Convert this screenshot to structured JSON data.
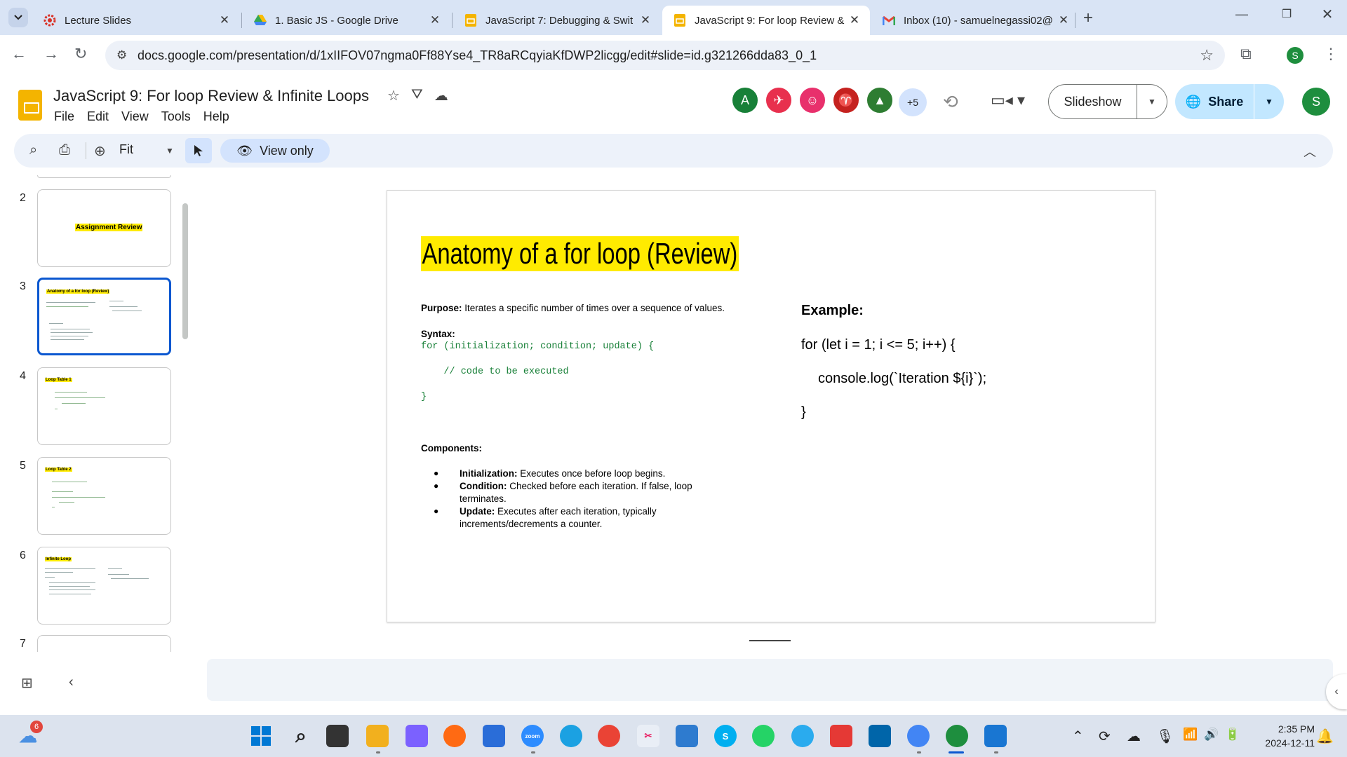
{
  "browser": {
    "tabs": [
      {
        "title": "Lecture Slides",
        "icon": "gear-red-icon"
      },
      {
        "title": "1. Basic JS - Google Drive",
        "icon": "google-drive-icon"
      },
      {
        "title": "JavaScript 7: Debugging & Swit",
        "icon": "google-slides-icon"
      },
      {
        "title": "JavaScript 9: For loop Review &",
        "icon": "google-slides-icon",
        "active": true
      },
      {
        "title": "Inbox (10) - samuelnegassi02@",
        "icon": "gmail-icon"
      }
    ],
    "url": "docs.google.com/presentation/d/1xIIFOV07ngma0Ff88Yse4_TR8aRCqyiaKfDWP2licgg/edit#slide=id.g321266dda83_0_1",
    "profile_initial": "S"
  },
  "doc": {
    "title": "JavaScript 9: For loop Review & Infinite Loops",
    "menu": [
      "File",
      "Edit",
      "View",
      "Tools",
      "Help"
    ],
    "collaborators": [
      {
        "initial": "A",
        "color": "#188038"
      },
      {
        "initial": "✈",
        "color": "#e8304e"
      },
      {
        "initial": "☺",
        "color": "#e8306c"
      },
      {
        "initial": "♈",
        "color": "#c5221f"
      },
      {
        "initial": "▲",
        "color": "#2e7d32"
      }
    ],
    "more_collaborators": "+5",
    "slideshow_label": "Slideshow",
    "share_label": "Share",
    "user_initial": "S"
  },
  "toolbar": {
    "zoom_label": "Fit",
    "view_only_label": "View only"
  },
  "filmstrip": {
    "slides": [
      {
        "num": "2",
        "title": "Assignment Review"
      },
      {
        "num": "3",
        "title": "Anatomy of a for loop (Review)",
        "selected": true
      },
      {
        "num": "4",
        "title": "Loop Table 1"
      },
      {
        "num": "5",
        "title": "Loop Table 2"
      },
      {
        "num": "6",
        "title": "Infinite Loop"
      },
      {
        "num": "7",
        "title": ""
      }
    ]
  },
  "slide": {
    "title": "Anatomy of a for loop (Review)",
    "purpose_label": "Purpose:",
    "purpose_text": " Iterates a specific number of times over a sequence of values.",
    "syntax_label": "Syntax:",
    "syntax_lines": [
      "for (initialization; condition; update) {",
      "    // code to be executed",
      "}"
    ],
    "components_label": "Components:",
    "components": [
      {
        "label": "Initialization:",
        "text": " Executes once before loop begins."
      },
      {
        "label": "Condition:",
        "text": " Checked before each iteration. If false, loop terminates."
      },
      {
        "label": "Update:",
        "text": " Executes after each iteration, typically increments/decrements a counter."
      }
    ],
    "example_label": "Example:",
    "example_lines": [
      "for (let i = 1; i <= 5; i++) {",
      "console.log(`Iteration ${i}`);",
      "}"
    ]
  },
  "taskbar": {
    "weather_badge": "6",
    "time": "2:35 PM",
    "date": "2024-12-11"
  },
  "colors": {
    "tabstrip_bg": "#d9e4f5",
    "accent_blue": "#0b57d0",
    "title_highlight": "#ffeb00",
    "code_green": "#188038",
    "share_bg": "#c2e7ff"
  }
}
